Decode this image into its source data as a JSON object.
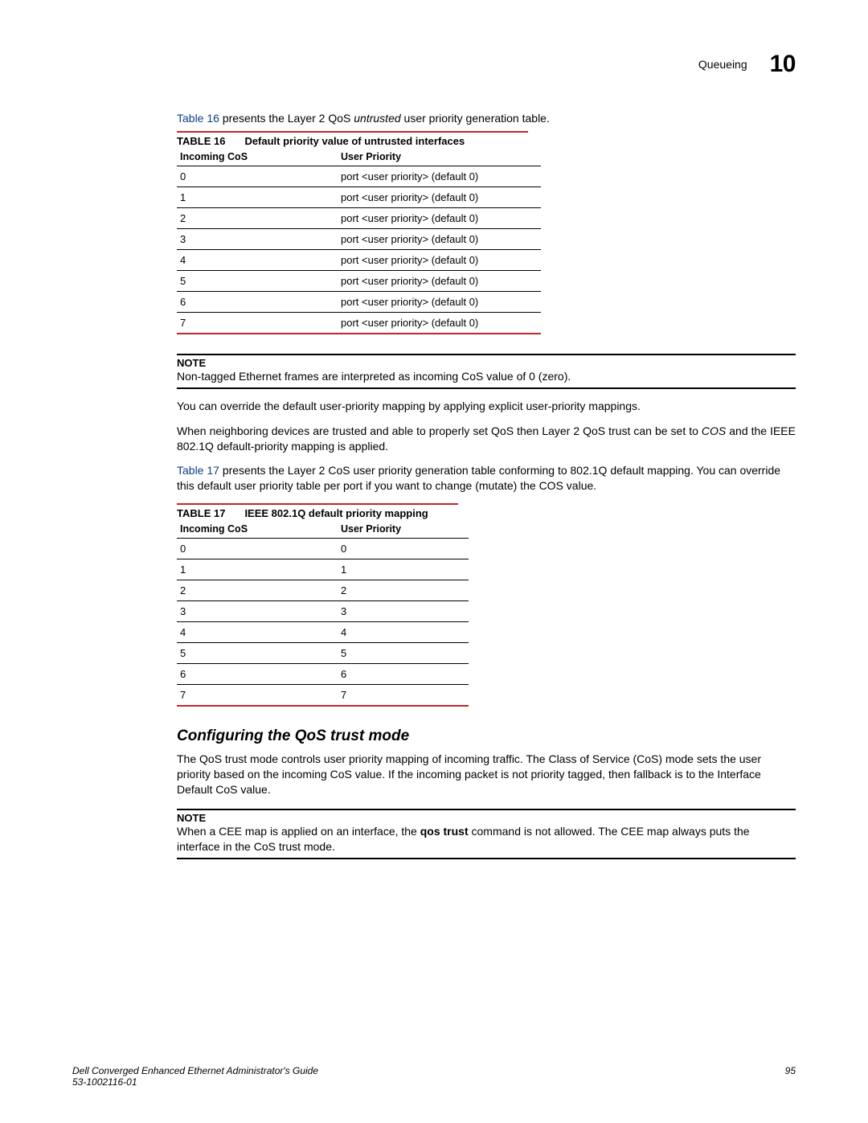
{
  "header": {
    "section": "Queueing",
    "chapter": "10"
  },
  "intro_t16_pre": "Table 16",
  "intro_t16_mid": " presents the Layer 2 QoS ",
  "intro_t16_em": "untrusted",
  "intro_t16_post": " user priority generation table.",
  "table16": {
    "label": "TABLE 16",
    "title": "Default priority value of untrusted interfaces",
    "col1": "Incoming CoS",
    "col2": "User Priority",
    "rows": [
      {
        "cos": "0",
        "pri": "port <user priority> (default 0)"
      },
      {
        "cos": "1",
        "pri": "port <user priority> (default 0)"
      },
      {
        "cos": "2",
        "pri": "port <user priority> (default 0)"
      },
      {
        "cos": "3",
        "pri": "port <user priority> (default 0)"
      },
      {
        "cos": "4",
        "pri": "port <user priority> (default 0)"
      },
      {
        "cos": "5",
        "pri": "port <user priority> (default 0)"
      },
      {
        "cos": "6",
        "pri": "port <user priority> (default 0)"
      },
      {
        "cos": "7",
        "pri": "port <user priority> (default 0)"
      }
    ]
  },
  "note1": {
    "heading": "NOTE",
    "body": "Non-tagged Ethernet frames are interpreted as incoming CoS value of 0 (zero)."
  },
  "para1": "You can override the default user-priority mapping by applying explicit user-priority mappings.",
  "para2_pre": "When neighboring devices are trusted and able to properly set QoS then Layer 2 QoS trust can be set to ",
  "para2_em": "COS",
  "para2_post": " and the IEEE 802.1Q default-priority mapping is applied.",
  "para3_pre": "Table 17",
  "para3_post": " presents the Layer 2 CoS user priority generation table conforming to 802.1Q default mapping. You can override this default user priority table per port if you want to change (mutate) the COS value.",
  "table17": {
    "label": "TABLE 17",
    "title": "IEEE 802.1Q default priority mapping",
    "col1": "Incoming CoS",
    "col2": "User Priority",
    "rows": [
      {
        "cos": "0",
        "pri": "0"
      },
      {
        "cos": "1",
        "pri": "1"
      },
      {
        "cos": "2",
        "pri": "2"
      },
      {
        "cos": "3",
        "pri": "3"
      },
      {
        "cos": "4",
        "pri": "4"
      },
      {
        "cos": "5",
        "pri": "5"
      },
      {
        "cos": "6",
        "pri": "6"
      },
      {
        "cos": "7",
        "pri": "7"
      }
    ]
  },
  "section_heading": "Configuring the QoS trust mode",
  "para4": "The QoS trust mode controls user priority mapping of incoming traffic. The Class of Service (CoS) mode sets the user priority based on the incoming CoS value. If the incoming packet is not priority tagged, then fallback is to the Interface Default CoS value.",
  "note2": {
    "heading": "NOTE",
    "body_pre": "When a CEE map is applied on an interface, the ",
    "body_cmd": "qos trust",
    "body_post": " command is not allowed. The CEE map always puts the interface in the CoS trust mode."
  },
  "footer": {
    "title": "Dell Converged Enhanced Ethernet Administrator's Guide",
    "doc": "53-1002116-01",
    "page": "95"
  }
}
